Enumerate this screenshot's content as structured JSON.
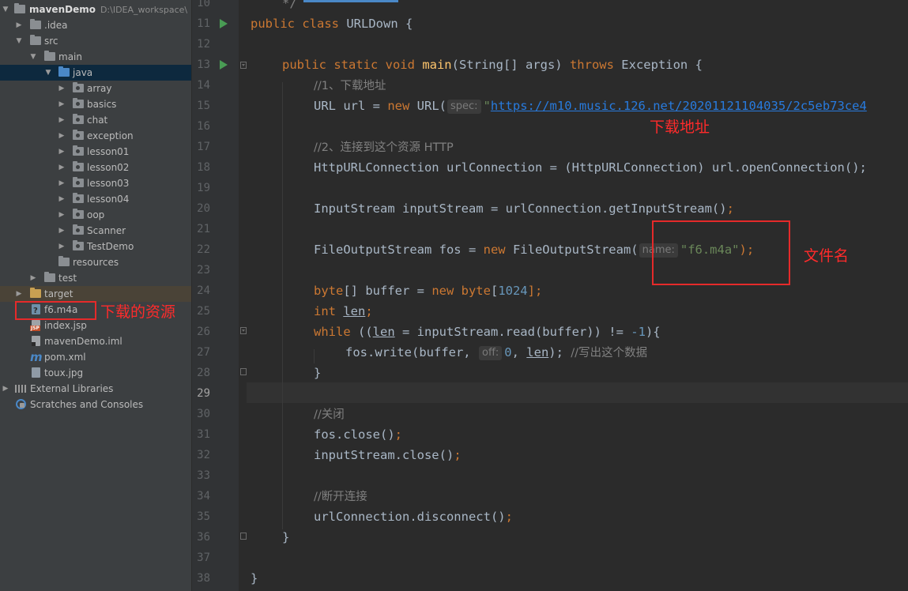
{
  "project_tree": {
    "root_name": "mavenDemo",
    "root_path": "D:\\IDEA_workspace\\",
    "items": [
      {
        "label": "mavenDemo",
        "kind": "root"
      },
      {
        "label": ".idea",
        "kind": "folder"
      },
      {
        "label": "src",
        "kind": "folder"
      },
      {
        "label": "main",
        "kind": "folder"
      },
      {
        "label": "java",
        "kind": "source-folder"
      },
      {
        "label": "array",
        "kind": "package"
      },
      {
        "label": "basics",
        "kind": "package"
      },
      {
        "label": "chat",
        "kind": "package"
      },
      {
        "label": "exception",
        "kind": "package"
      },
      {
        "label": "lesson01",
        "kind": "package"
      },
      {
        "label": "lesson02",
        "kind": "package"
      },
      {
        "label": "lesson03",
        "kind": "package"
      },
      {
        "label": "lesson04",
        "kind": "package"
      },
      {
        "label": "oop",
        "kind": "package"
      },
      {
        "label": "Scanner",
        "kind": "package"
      },
      {
        "label": "TestDemo",
        "kind": "package"
      },
      {
        "label": "resources",
        "kind": "resources-folder"
      },
      {
        "label": "test",
        "kind": "folder"
      },
      {
        "label": "target",
        "kind": "excluded-folder"
      },
      {
        "label": "f6.m4a",
        "kind": "file"
      },
      {
        "label": "index.jsp",
        "kind": "jsp-file"
      },
      {
        "label": "mavenDemo.iml",
        "kind": "iml-file"
      },
      {
        "label": "pom.xml",
        "kind": "maven-file"
      },
      {
        "label": "toux.jpg",
        "kind": "image-file"
      },
      {
        "label": "External Libraries",
        "kind": "libraries"
      },
      {
        "label": "Scratches and Consoles",
        "kind": "scratches"
      }
    ]
  },
  "editor": {
    "line_numbers": [
      "10",
      "11",
      "12",
      "13",
      "14",
      "15",
      "16",
      "17",
      "18",
      "19",
      "20",
      "21",
      "22",
      "23",
      "24",
      "25",
      "26",
      "27",
      "28",
      "29",
      "30",
      "31",
      "32",
      "33",
      "34",
      "35",
      "36",
      "37",
      "38"
    ],
    "current_line": "29",
    "lines": {
      "l10": "*/",
      "l11_kw": "public class ",
      "l11_name": "URLDown {",
      "l13_kw1": "public static void ",
      "l13_fn": "main",
      "l13_mid": "(String[] args) ",
      "l13_kw2": "throws ",
      "l13_end": "Exception {",
      "l14": "//1、下载地址",
      "l15_a": "URL url = ",
      "l15_new": "new ",
      "l15_b": "URL(",
      "l15_hint": "spec:",
      "l15_q": "\"",
      "l15_url": "https://m10.music.126.net/20201121104035/2c5eb73ce4",
      "l17": "//2、连接到这个资源 HTTP",
      "l18": "HttpURLConnection urlConnection = (HttpURLConnection) url.openConnection();",
      "l20_a": "InputStream inputStream = urlConnection.getInputStream()",
      "l20_semi": ";",
      "l22_a": "FileOutputStream fos = ",
      "l22_new": "new ",
      "l22_b": "FileOutputStream(",
      "l22_hint": "name:",
      "l22_str": "\"f6.m4a\"",
      "l22_c": ");",
      "l24_kw1": "byte",
      "l24_a": "[] buffer = ",
      "l24_new": "new ",
      "l24_kw2": "byte",
      "l24_b": "[",
      "l24_num": "1024",
      "l24_c": "];",
      "l25_kw": "int ",
      "l25_var": "len",
      "l25_semi": ";",
      "l26_kw": "while ",
      "l26_a": "((",
      "l26_var": "len",
      "l26_b": " = inputStream.read(buffer)) != ",
      "l26_num": "-1",
      "l26_c": "){",
      "l27_a": "fos.write(buffer,",
      "l27_hint": "off:",
      "l27_num": "0",
      "l27_b": ", ",
      "l27_var": "len",
      "l27_c": "); ",
      "l27_cmt": "//写出这个数据",
      "l28": "}",
      "l30": "//关闭",
      "l31_a": "fos.close()",
      "l31_semi": ";",
      "l32_a": "inputStream.close()",
      "l32_semi": ";",
      "l34": "//断开连接",
      "l35_a": "urlConnection.disconnect()",
      "l35_semi": ";",
      "l36": "}",
      "l38": "}"
    }
  },
  "annotations": {
    "download_url_label": "下载地址",
    "file_name_label": "文件名",
    "downloaded_resource_label": "下载的资源",
    "color": "#ff2b2b"
  },
  "theme": {
    "background": "#2b2b2b",
    "sidebar": "#3c3f41",
    "keyword": "#cc7832",
    "string": "#6a8759",
    "number": "#6897bb",
    "function": "#ffc66d"
  }
}
